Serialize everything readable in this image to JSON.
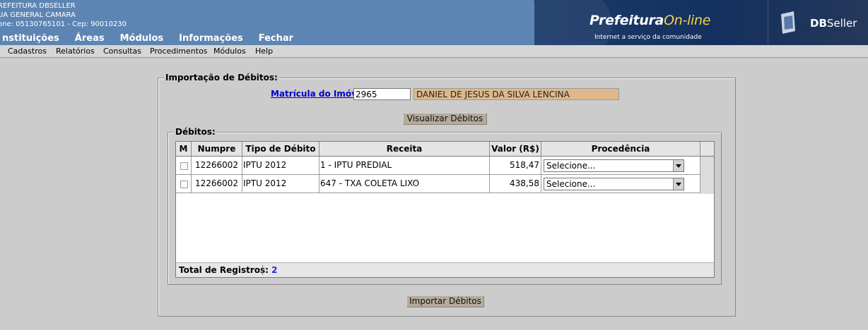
{
  "header": {
    "line1": "REFEITURA DBSELLER",
    "line2": "UA GENERAL CAMARA",
    "line3": "one: 05130765101  -  Cep: 90010230",
    "brand_title_main": "Prefeitura",
    "brand_title_accent": "On-line",
    "brand_subtitle": "Internet a serviço da comunidade",
    "company_bold": "DB",
    "company_light": "Seller",
    "nav": [
      "nstituições",
      "Áreas",
      "Módulos",
      "Informações",
      "Fechar"
    ]
  },
  "menubar": [
    "Cadastros",
    "Relatórios",
    "Consultas",
    "Procedimentos",
    "Módulos",
    "Help"
  ],
  "form": {
    "legend": "Importação de Débitos:",
    "matricula_label": "Matrícula do Imóvel:",
    "matricula_value": "2965",
    "owner_name": "DANIEL DE JESUS DA SILVA LENCINA",
    "visualizar_button": "Visualizar Débitos",
    "importar_button": "Importar Débitos"
  },
  "debitos": {
    "legend": "Débitos:",
    "columns": [
      "M",
      "Numpre",
      "Tipo de Débito",
      "Receita",
      "Valor (R$)",
      "Procedência"
    ],
    "rows": [
      {
        "numpre": "12266002",
        "tipo": "IPTU 2012",
        "receita": "1 - IPTU PREDIAL",
        "valor": "518,47",
        "procedencia": "Selecione..."
      },
      {
        "numpre": "12266002",
        "tipo": "IPTU 2012",
        "receita": "647 - TXA COLETA LIXO",
        "valor": "438,58",
        "procedencia": "Selecione..."
      }
    ],
    "total_label": "Total de Registros:",
    "total_value": "2"
  },
  "colors": {
    "header_blue": "#5d85b3",
    "logo_navy": "#14305e",
    "brand_accent": "#f2d34a",
    "owner_field_bg": "#dfb88a",
    "button_bg": "#b5aa9c",
    "link_blue": "#0000cc"
  }
}
